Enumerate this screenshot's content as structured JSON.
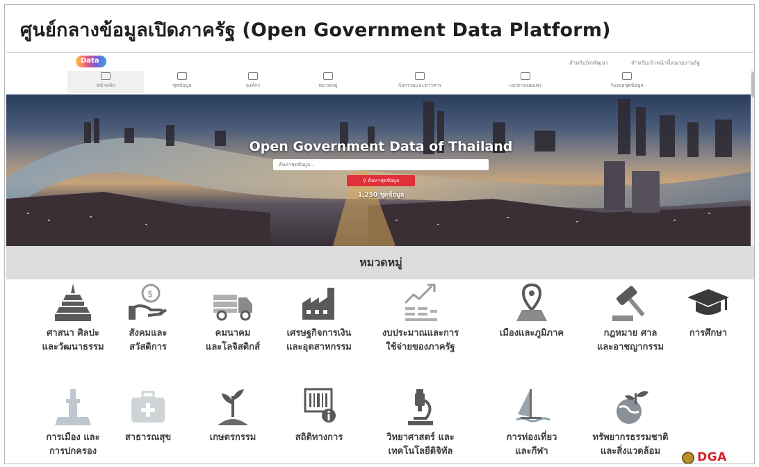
{
  "slide": {
    "title": "ศูนย์กลางข้อมูลเปิดภาครัฐ (Open Government Data Platform)"
  },
  "site": {
    "logo_text": "Data",
    "top_links": [
      "สำหรับนักพัฒนา",
      "สำหรับเจ้าหน้าที่หน่วยงานรัฐ"
    ],
    "nav": [
      {
        "label": "หน้าหลัก",
        "icon": "home-icon"
      },
      {
        "label": "ชุดข้อมูล",
        "icon": "folder-icon"
      },
      {
        "label": "องค์กร",
        "icon": "building-icon"
      },
      {
        "label": "หมวดหมู่",
        "icon": "eye-icon"
      },
      {
        "label": "กิจกรรมและข่าวสาร",
        "icon": "megaphone-icon"
      },
      {
        "label": "เอกสารเผยแพร่",
        "icon": "document-icon"
      },
      {
        "label": "ร้องขอชุดข้อมูล",
        "icon": "request-icon"
      }
    ],
    "hero": {
      "title": "Open Government Data of Thailand",
      "search_placeholder": "ค้นหาชุดข้อมูล...",
      "search_button": "ค้นหาชุดข้อมูล",
      "dataset_count": "1,250 ชุดข้อมูล"
    },
    "categories_heading": "หมวดหมู่",
    "categories": [
      {
        "label": "ศาสนา ศิลปะ\nและวัฒนาธรรม",
        "icon": "temple-icon"
      },
      {
        "label": "สังคมและ\nสวัสดิการ",
        "icon": "coin-hand-icon"
      },
      {
        "label": "คมนาคม\nและโลจิสติกส์",
        "icon": "truck-icon"
      },
      {
        "label": "เศรษฐกิจการเงิน\nและอุตสาหกรรม",
        "icon": "factory-icon"
      },
      {
        "label": "งบประมาณและการ\nใช้จ่ายของภาครัฐ",
        "icon": "trend-chart-icon"
      },
      {
        "label": "เมืองและภูมิภาค",
        "icon": "map-pin-icon"
      },
      {
        "label": "กฎหมาย ศาล\nและอาชญากรรม",
        "icon": "gavel-icon"
      },
      {
        "label": "การศึกษา",
        "icon": "graduation-cap-icon"
      },
      {
        "label": "การเมือง และ\nการปกครอง",
        "icon": "monument-icon"
      },
      {
        "label": "สาธารณสุข",
        "icon": "medical-kit-icon"
      },
      {
        "label": "เกษตรกรรม",
        "icon": "sprout-icon"
      },
      {
        "label": "สถิติทางการ",
        "icon": "barcode-info-icon"
      },
      {
        "label": "วิทยาศาสตร์ และ\nเทคโนโลยีดิจิทัล",
        "icon": "microscope-icon"
      },
      {
        "label": "การท่องเที่ยว\nและกีฬา",
        "icon": "windsurf-icon"
      },
      {
        "label": "ทรัพยากรธรรมชาติ\nและสิ่งแวดล้อม",
        "icon": "globe-leaf-icon"
      }
    ],
    "footer_logo": "DGA",
    "colors": {
      "accent": "#e0303a",
      "icon_gray": "#5a5a5a",
      "band": "#dcdcdc",
      "dga_red": "#d8232a"
    }
  }
}
